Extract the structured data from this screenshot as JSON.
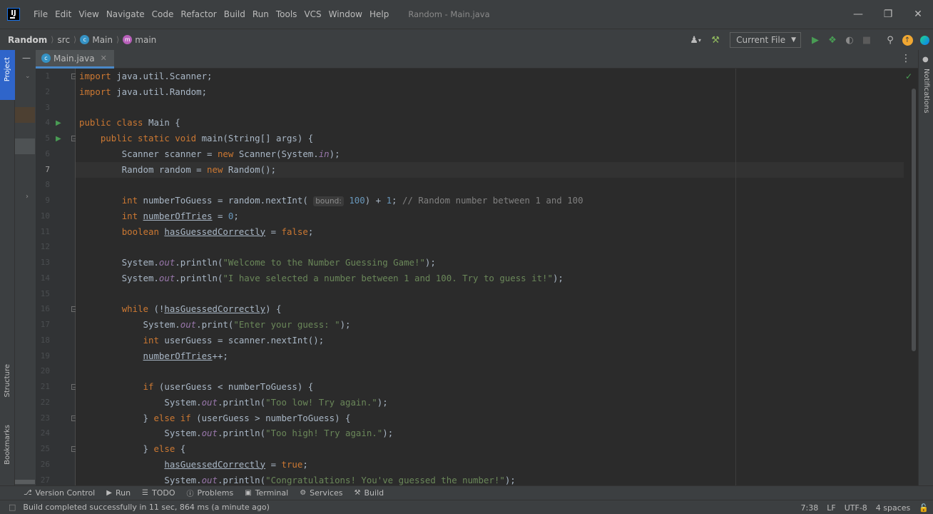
{
  "titlebar": {
    "menu": [
      "File",
      "Edit",
      "View",
      "Navigate",
      "Code",
      "Refactor",
      "Build",
      "Run",
      "Tools",
      "VCS",
      "Window",
      "Help"
    ],
    "window_title": "Random - Main.java"
  },
  "navbar": {
    "project": "Random",
    "src": "src",
    "class": "Main",
    "method": "main",
    "run_config": "Current File"
  },
  "left_strip": {
    "project": "Project",
    "structure": "Structure",
    "bookmarks": "Bookmarks"
  },
  "right_strip": {
    "notifications": "Notifications"
  },
  "editor": {
    "tab_label": "Main.java",
    "active_line": 7,
    "lines": [
      {
        "n": 1,
        "html": "<span class='kw'>import</span> java.util.Scanner;"
      },
      {
        "n": 2,
        "html": "<span class='kw'>import</span> java.util.Random;"
      },
      {
        "n": 3,
        "html": ""
      },
      {
        "n": 4,
        "html": "<span class='kw'>public class</span> Main {"
      },
      {
        "n": 5,
        "html": "    <span class='kw'>public static void</span> main(String[] args) {"
      },
      {
        "n": 6,
        "html": "        Scanner scanner = <span class='kw'>new</span> Scanner(System.<span class='st'>in</span>);"
      },
      {
        "n": 7,
        "html": "        Random random = <span class='kw'>new</span> Random();"
      },
      {
        "n": 8,
        "html": ""
      },
      {
        "n": 9,
        "html": "        <span class='kw'>int</span> numberToGuess = random.nextInt( <span class='hint'>bound:</span> <span class='num'>100</span>) + <span class='num'>1</span>; <span class='cmt'>// Random number between 1 and 100</span>"
      },
      {
        "n": 10,
        "html": "        <span class='kw'>int</span> <span class='uv'>numberOfTries</span> = <span class='num'>0</span>;"
      },
      {
        "n": 11,
        "html": "        <span class='kw'>boolean</span> <span class='uv'>hasGuessedCorrectly</span> = <span class='kw'>false</span>;"
      },
      {
        "n": 12,
        "html": ""
      },
      {
        "n": 13,
        "html": "        System.<span class='st'>out</span>.println(<span class='str'>\"Welcome to the Number Guessing Game!\"</span>);"
      },
      {
        "n": 14,
        "html": "        System.<span class='st'>out</span>.println(<span class='str'>\"I have selected a number between 1 and 100. Try to guess it!\"</span>);"
      },
      {
        "n": 15,
        "html": ""
      },
      {
        "n": 16,
        "html": "        <span class='kw'>while</span> (!<span class='uv'>hasGuessedCorrectly</span>) {"
      },
      {
        "n": 17,
        "html": "            System.<span class='st'>out</span>.print(<span class='str'>\"Enter your guess: \"</span>);"
      },
      {
        "n": 18,
        "html": "            <span class='kw'>int</span> userGuess = scanner.nextInt();"
      },
      {
        "n": 19,
        "html": "            <span class='uv'>numberOfTries</span>++;"
      },
      {
        "n": 20,
        "html": ""
      },
      {
        "n": 21,
        "html": "            <span class='kw'>if</span> (userGuess &lt; numberToGuess) {"
      },
      {
        "n": 22,
        "html": "                System.<span class='st'>out</span>.println(<span class='str'>\"Too low! Try again.\"</span>);"
      },
      {
        "n": 23,
        "html": "            } <span class='kw'>else if</span> (userGuess &gt; numberToGuess) {"
      },
      {
        "n": 24,
        "html": "                System.<span class='st'>out</span>.println(<span class='str'>\"Too high! Try again.\"</span>);"
      },
      {
        "n": 25,
        "html": "            } <span class='kw'>else</span> {"
      },
      {
        "n": 26,
        "html": "                <span class='uv'>hasGuessedCorrectly</span> = <span class='kw'>true</span>;"
      },
      {
        "n": 27,
        "html": "                System.<span class='st'>out</span>.println(<span class='str'>\"Congratulations! You've guessed the number!\"</span>);"
      }
    ]
  },
  "toolwindows": [
    "Version Control",
    "Run",
    "TODO",
    "Problems",
    "Terminal",
    "Services",
    "Build"
  ],
  "status": {
    "message": "Build completed successfully in 11 sec, 864 ms (a minute ago)",
    "position": "7:38",
    "line_sep": "LF",
    "encoding": "UTF-8",
    "indent": "4 spaces"
  },
  "colors": {
    "keyword": "#cc7832",
    "string": "#6a8759",
    "number": "#6897bb",
    "comment": "#808080",
    "static_field": "#9876aa",
    "accent": "#2f65ca"
  }
}
